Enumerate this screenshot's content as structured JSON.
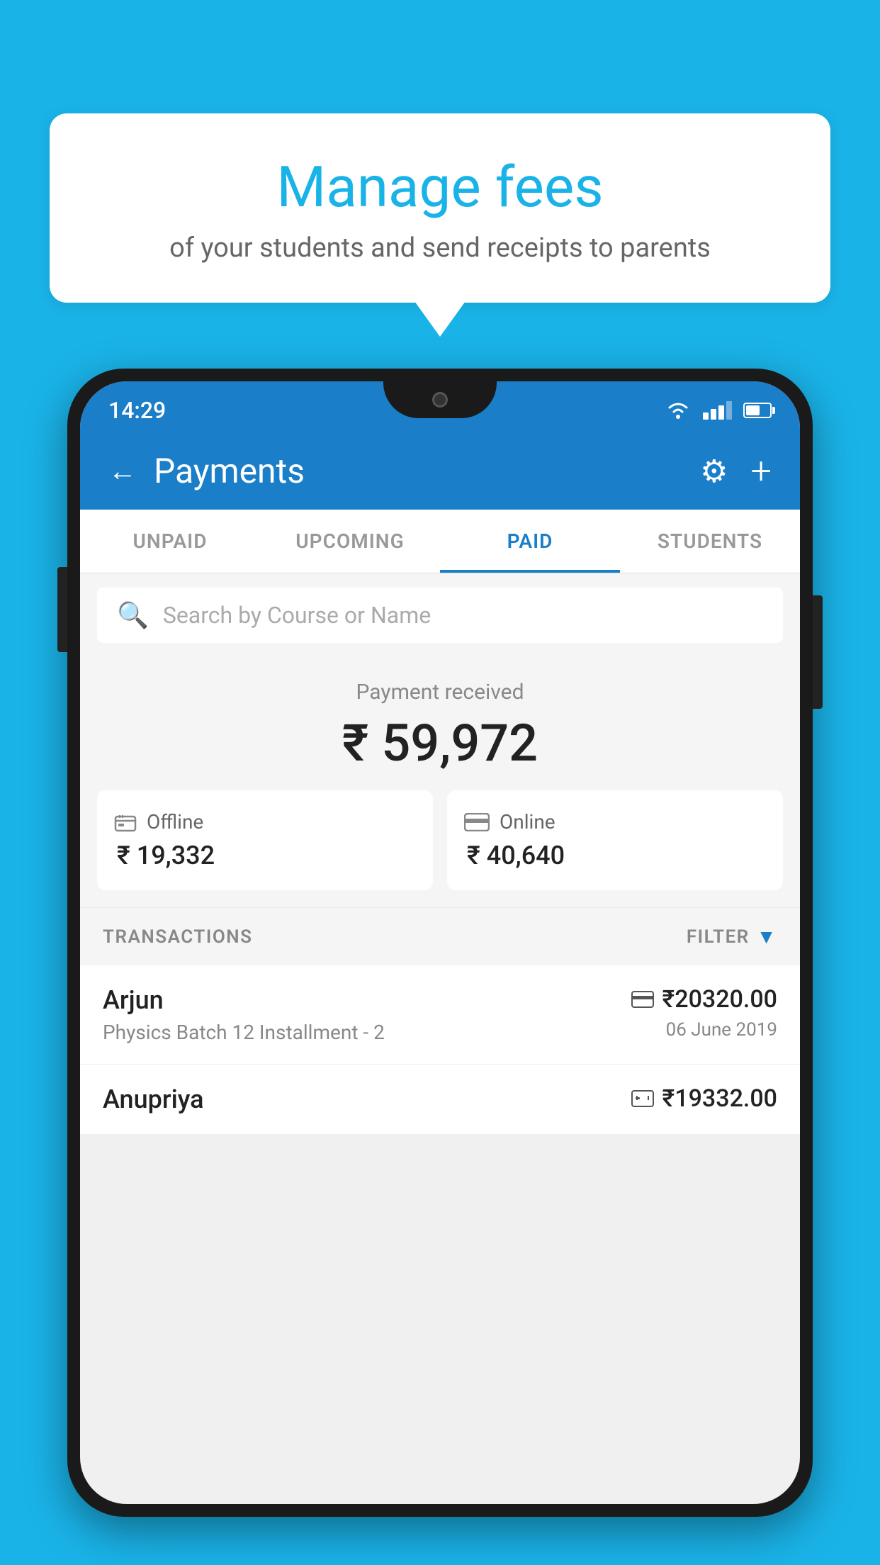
{
  "background_color": "#1ab3e8",
  "speech_bubble": {
    "title": "Manage fees",
    "subtitle": "of your students and send receipts to parents"
  },
  "status_bar": {
    "time": "14:29"
  },
  "header": {
    "title": "Payments",
    "back_label": "←",
    "plus_label": "+"
  },
  "tabs": [
    {
      "label": "UNPAID",
      "active": false
    },
    {
      "label": "UPCOMING",
      "active": false
    },
    {
      "label": "PAID",
      "active": true
    },
    {
      "label": "STUDENTS",
      "active": false
    }
  ],
  "search": {
    "placeholder": "Search by Course or Name"
  },
  "payment_summary": {
    "label": "Payment received",
    "amount": "₹ 59,972",
    "offline": {
      "label": "Offline",
      "amount": "₹ 19,332"
    },
    "online": {
      "label": "Online",
      "amount": "₹ 40,640"
    }
  },
  "transactions": {
    "header_label": "TRANSACTIONS",
    "filter_label": "FILTER",
    "rows": [
      {
        "name": "Arjun",
        "course": "Physics Batch 12 Installment - 2",
        "amount": "₹20320.00",
        "payment_type": "online",
        "date": "06 June 2019"
      },
      {
        "name": "Anupriya",
        "course": "",
        "amount": "₹19332.00",
        "payment_type": "offline",
        "date": ""
      }
    ]
  }
}
